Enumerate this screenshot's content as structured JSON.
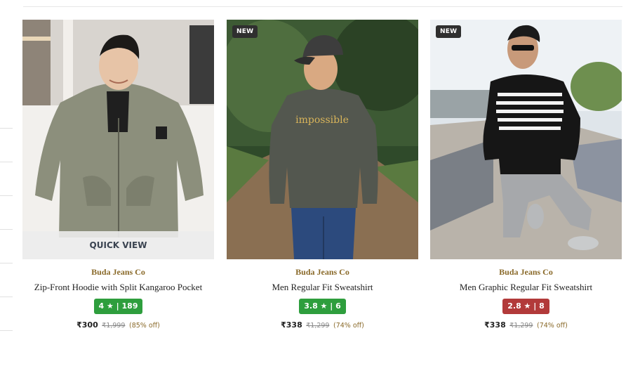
{
  "products": [
    {
      "brand": "Buda Jeans Co",
      "name": "Zip-Front Hoodie with Split Kangaroo Pocket",
      "rating_label": "4 ★ | 189",
      "rating_color": "#2e9e3d",
      "price": "₹300",
      "mrp": "₹1,999",
      "discount": "(85% off)",
      "quick_view": "QUICK VIEW",
      "image": "man-in-olive-zip-hoodie"
    },
    {
      "brand": "Buda Jeans Co",
      "name": "Men Regular Fit Sweatshirt",
      "rating_label": "3.8 ★ | 6",
      "rating_color": "#2e9e3d",
      "price": "₹338",
      "mrp": "₹1,299",
      "discount": "(74% off)",
      "badge": "NEW",
      "graphic_text": "impossible",
      "image": "man-in-grey-sweatshirt-in-forest"
    },
    {
      "brand": "Buda Jeans Co",
      "name": "Men Graphic Regular Fit Sweatshirt",
      "rating_label": "2.8 ★ | 8",
      "rating_color": "#b23a3a",
      "price": "₹338",
      "mrp": "₹1,299",
      "discount": "(74% off)",
      "badge": "NEW",
      "image": "man-in-striped-black-sweatshirt-at-skatepark"
    }
  ],
  "colors": {
    "brand_text": "#8a6a2a",
    "badge_bg": "#2f2f2f"
  }
}
